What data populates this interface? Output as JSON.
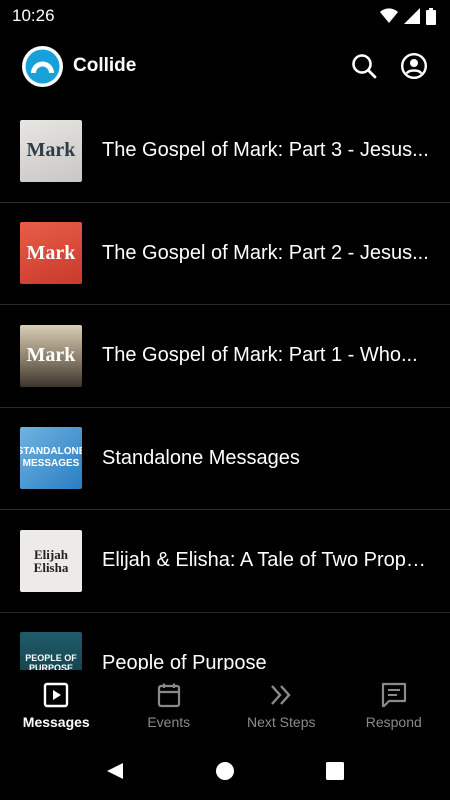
{
  "status": {
    "time": "10:26"
  },
  "header": {
    "title": "Collide"
  },
  "items": [
    {
      "title": "The Gospel of Mark: Part 3 - Jesus...",
      "thumb_text": "Mark"
    },
    {
      "title": "The Gospel of Mark: Part 2 - Jesus...",
      "thumb_text": "Mark"
    },
    {
      "title": "The Gospel of Mark: Part 1 - Who...",
      "thumb_text": "Mark"
    },
    {
      "title": "Standalone Messages",
      "thumb_text": "STANDALONE MESSAGES"
    },
    {
      "title": "Elijah & Elisha: A Tale of Two Prophets",
      "thumb_text": "Elijah Elisha"
    },
    {
      "title": "People of Purpose",
      "thumb_text": "PEOPLE OF PURPOSE"
    }
  ],
  "tabs": [
    {
      "label": "Messages",
      "icon": "play-square-icon",
      "active": true
    },
    {
      "label": "Events",
      "icon": "calendar-icon",
      "active": false
    },
    {
      "label": "Next Steps",
      "icon": "double-chevron-icon",
      "active": false
    },
    {
      "label": "Respond",
      "icon": "message-icon",
      "active": false
    }
  ],
  "colors": {
    "background": "#000000",
    "active_tab": "#ffffff",
    "inactive_tab": "#8a8a8a"
  }
}
